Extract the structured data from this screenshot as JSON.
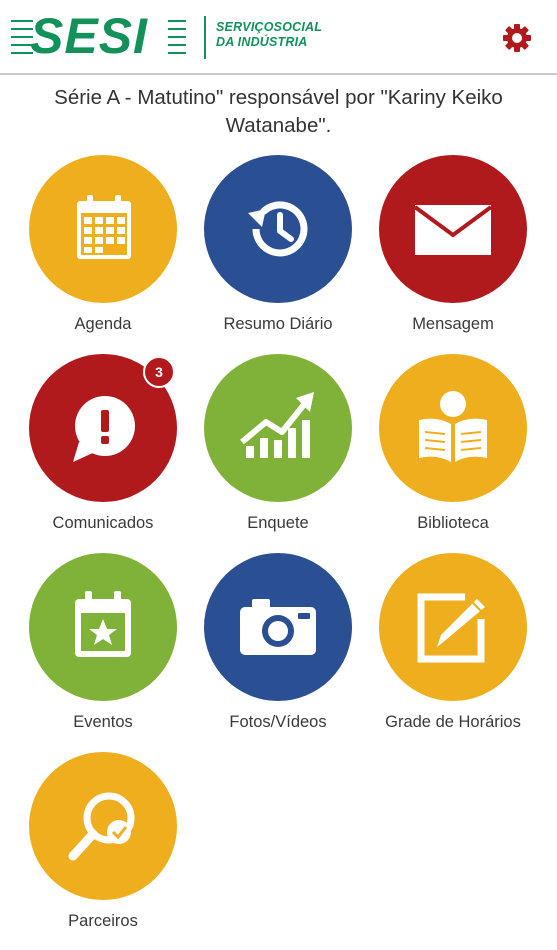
{
  "header": {
    "logo_text": "SESI",
    "logo_sub_line1": "SERVIÇOSOCIAL",
    "logo_sub_line2": "DA INDÚSTRIA",
    "settings_icon": "gear-icon"
  },
  "description": {
    "line1": "Série A - Matutino\" responsável por \"Kariny Keiko",
    "line2": "Watanabe\"."
  },
  "colors": {
    "yellow": "#eeae1d",
    "blue": "#2b4f93",
    "red": "#b11a1c",
    "green": "#80b23a",
    "brand_green": "#12925a"
  },
  "menu": [
    {
      "label": "Agenda",
      "icon": "calendar-icon",
      "color": "#eeae1d"
    },
    {
      "label": "Resumo Diário",
      "icon": "history-icon",
      "color": "#2b4f93"
    },
    {
      "label": "Mensagem",
      "icon": "envelope-icon",
      "color": "#b11a1c"
    },
    {
      "label": "Comunicados",
      "icon": "alert-bubble-icon",
      "color": "#b11a1c",
      "badge": "3"
    },
    {
      "label": "Enquete",
      "icon": "growth-chart-icon",
      "color": "#80b23a"
    },
    {
      "label": "Biblioteca",
      "icon": "reader-icon",
      "color": "#eeae1d"
    },
    {
      "label": "Eventos",
      "icon": "calendar-star-icon",
      "color": "#80b23a"
    },
    {
      "label": "Fotos/Vídeos",
      "icon": "camera-icon",
      "color": "#2b4f93"
    },
    {
      "label": "Grade de Horários",
      "icon": "edit-icon",
      "color": "#eeae1d"
    },
    {
      "label": "Parceiros",
      "icon": "search-check-icon",
      "color": "#eeae1d"
    }
  ]
}
